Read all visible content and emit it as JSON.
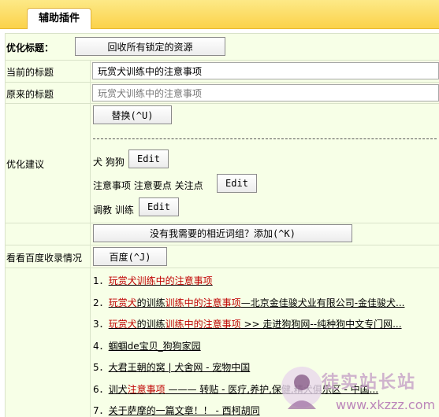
{
  "header": {
    "tab_label": "辅助插件"
  },
  "optimize_title": {
    "label": "优化标题：",
    "recover_button": "回收所有锁定的资源"
  },
  "current_title": {
    "label": "当前的标题",
    "value": "玩赏犬训练中的注意事项"
  },
  "original_title": {
    "label": "原来的标题",
    "value": "玩赏犬训练中的注意事项"
  },
  "suggestions": {
    "label": "优化建议",
    "replace_button": "替换(^U)",
    "edit_label": "Edit",
    "groups": [
      {
        "words": "犬  狗狗"
      },
      {
        "words": "注意事项  注意要点  关注点"
      },
      {
        "words": "调教  训练"
      }
    ],
    "add_group_button": "没有我需要的相近词组？添加(^K)"
  },
  "baidu": {
    "label": "看看百度收录情况",
    "button": "百度(^J)"
  },
  "results": [
    {
      "num": "1．",
      "parts": [
        {
          "t": "玩赏犬训练中的注意事项",
          "hl": true
        }
      ]
    },
    {
      "num": "2．",
      "parts": [
        {
          "t": "玩赏犬",
          "hl": true
        },
        {
          "t": "的训练",
          "hl": false
        },
        {
          "t": "训练中的注意事项",
          "hl": true
        },
        {
          "t": "—北京金佳骏犬业有限公司-金佳骏犬...",
          "hl": false
        }
      ]
    },
    {
      "num": "3．",
      "parts": [
        {
          "t": "玩赏犬",
          "hl": true
        },
        {
          "t": "的训练",
          "hl": false
        },
        {
          "t": "训练中的注意事项",
          "hl": true
        },
        {
          "t": "  >> 走进狗狗网--纯种狗中文专门网...",
          "hl": false
        }
      ]
    },
    {
      "num": "4．",
      "parts": [
        {
          "t": "蝈蝈de宝贝_狗狗家园",
          "hl": false
        }
      ]
    },
    {
      "num": "5．",
      "parts": [
        {
          "t": "大君王朝的窝 | 犬舍网 - 宠物中国",
          "hl": false
        }
      ]
    },
    {
      "num": "6．",
      "parts": [
        {
          "t": "训犬",
          "hl": false
        },
        {
          "t": "注意事项",
          "hl": true
        },
        {
          "t": " ——— 转贴 - 医疗,养护,保健,精犬俱乐区 - 中国...",
          "hl": false
        }
      ]
    },
    {
      "num": "7．",
      "parts": [
        {
          "t": "关于萨摩的一篇文章！！ - 西柯胡同",
          "hl": false
        }
      ]
    }
  ],
  "watermark": {
    "line1": "徒实站长站",
    "line2": "www.xkzzz.com"
  }
}
